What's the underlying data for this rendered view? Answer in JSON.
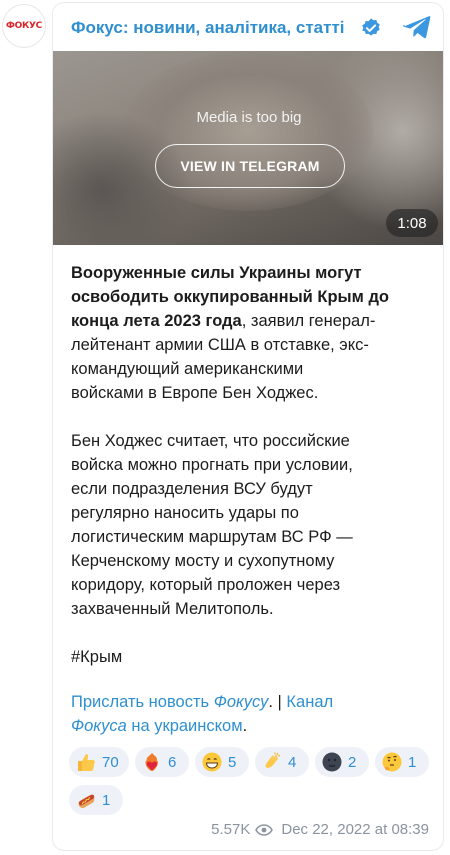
{
  "avatar": {
    "text": "ФОКУС"
  },
  "header": {
    "channel_name": "Фокус: новини, аналітика, статті",
    "verified_icon": "verified-badge-icon",
    "telegram_icon": "telegram-icon"
  },
  "media": {
    "notice": "Media is too big",
    "button_label": "VIEW IN TELEGRAM",
    "duration": "1:08"
  },
  "post": {
    "bold_lines": [
      "Вооруженные силы Украины могут",
      "освободить оккупированный Крым до",
      "конца лета 2023 года"
    ],
    "p1_tail": ", заявил генерал-",
    "p1_lines": [
      "лейтенант армии США в отставке, экс-",
      "командующий американскими",
      "войсками в Европе Бен Ходжес."
    ],
    "p2_lines": [
      "Бен Ходжес считает, что российские",
      "войска можно прогнать при условии,",
      "если подразделения ВСУ будут",
      "регулярно наносить удары по",
      "логистическим маршрутам ВС РФ —",
      "Керченскому мосту и сухопутному",
      "коридору, который проложен через",
      "захваченный Мелитополь."
    ],
    "hashtag": "#Крым",
    "links": {
      "part1": "Прислать новость ",
      "part2": "Фокусу",
      "part3": ". | ",
      "part4": "Канал",
      "part5": "Фокуса",
      "part6": " на украинском",
      "part7": "."
    }
  },
  "reactions": [
    {
      "emoji": "thumbs-up",
      "count": "70"
    },
    {
      "emoji": "heart-on-fire",
      "count": "6"
    },
    {
      "emoji": "grinning-face",
      "count": "5"
    },
    {
      "emoji": "clapping-hands",
      "count": "4"
    },
    {
      "emoji": "new-moon-face",
      "count": "2"
    },
    {
      "emoji": "thinking-face",
      "count": "1"
    },
    {
      "emoji": "hot-dog",
      "count": "1"
    }
  ],
  "footer": {
    "views": "5.57K",
    "date": "Dec 22, 2022 at 08:39"
  },
  "colors": {
    "link": "#2f8fcf",
    "chip_bg": "#eef1f8",
    "meta": "#8a94a0"
  }
}
